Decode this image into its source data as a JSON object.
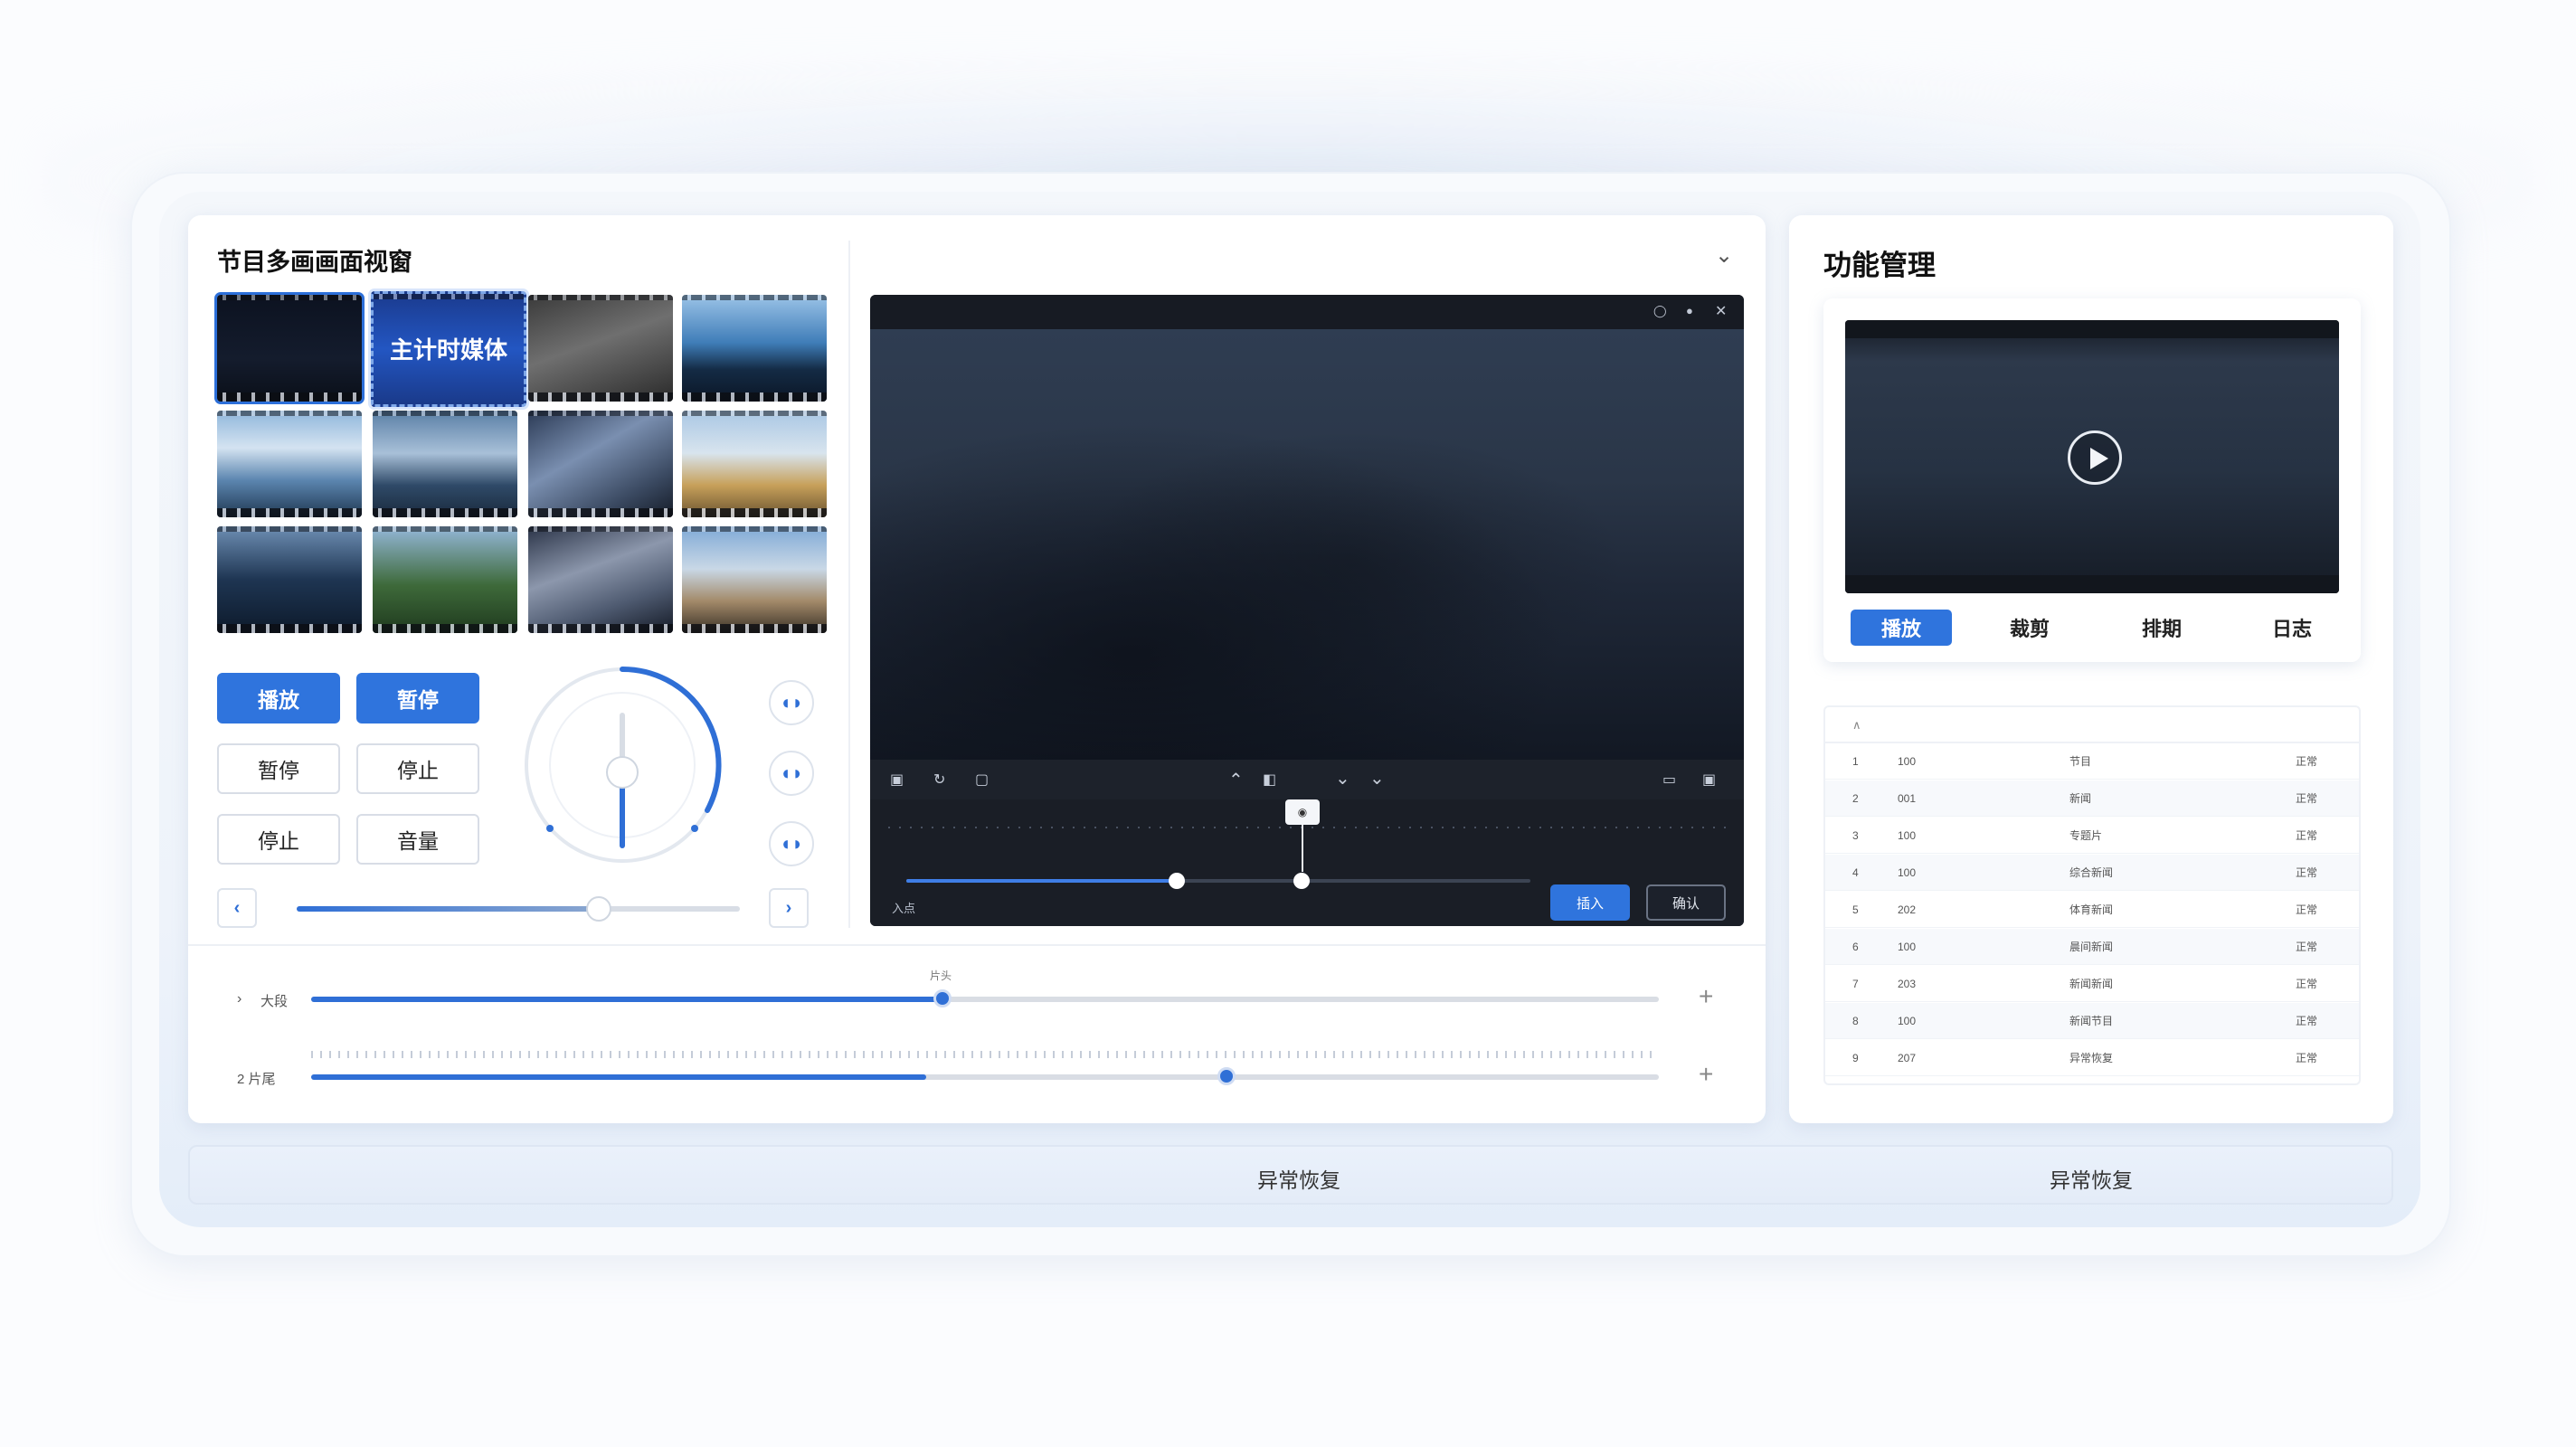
{
  "left_panel": {
    "title": "节目多画画面视窗",
    "thumbnail_text": "主计时媒体",
    "buttons": {
      "play": "播放",
      "pause_primary": "暂停",
      "pause": "暂停",
      "stop": "停止",
      "stop2": "停止",
      "volume": "音量"
    }
  },
  "player": {
    "confirm_label": "确认",
    "insert_label": "插入",
    "in_label": "入点"
  },
  "tracks": [
    {
      "label": "大段",
      "handle_label": "片头"
    },
    {
      "label": "2 片尾"
    }
  ],
  "right_panel": {
    "title": "功能管理",
    "tabs": [
      "播放",
      "裁剪",
      "排期",
      "日志"
    ],
    "table_rows": [
      {
        "index": "1",
        "code": "100",
        "name": "节目",
        "status": "正常"
      },
      {
        "index": "2",
        "code": "001",
        "name": "新闻",
        "status": "正常"
      },
      {
        "index": "3",
        "code": "100",
        "name": "专题片",
        "status": "正常"
      },
      {
        "index": "4",
        "code": "100",
        "name": "综合新闻",
        "status": "正常"
      },
      {
        "index": "5",
        "code": "202",
        "name": "体育新闻",
        "status": "正常"
      },
      {
        "index": "6",
        "code": "100",
        "name": "晨间新闻",
        "status": "正常"
      },
      {
        "index": "7",
        "code": "203",
        "name": "新闻新闻",
        "status": "正常"
      },
      {
        "index": "8",
        "code": "100",
        "name": "新闻节目",
        "status": "正常"
      },
      {
        "index": "9",
        "code": "207",
        "name": "异常恢复",
        "status": "正常"
      }
    ]
  },
  "footer": {
    "left_label": "异常恢复",
    "right_label": "异常恢复"
  },
  "colors": {
    "accent": "#2f74dd",
    "player_bg": "#1c212b"
  }
}
